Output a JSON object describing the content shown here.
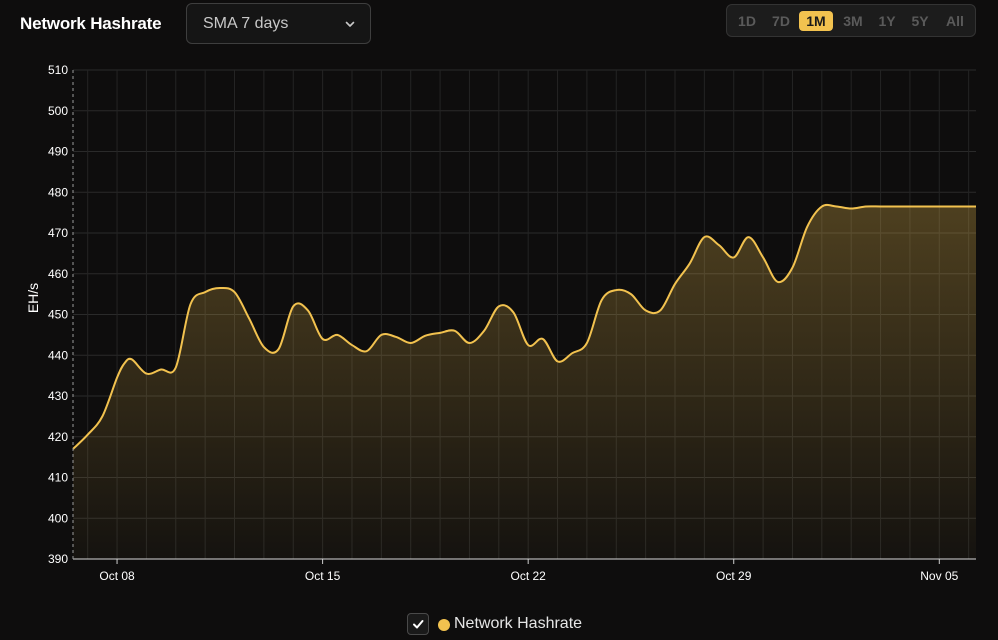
{
  "header": {
    "title": "Network Hashrate",
    "select_value": "SMA 7 days"
  },
  "range": {
    "options": [
      "1D",
      "7D",
      "1M",
      "3M",
      "1Y",
      "5Y",
      "All"
    ],
    "active": "1M"
  },
  "legend": {
    "label": "Network Hashrate"
  },
  "colors": {
    "accent": "#f2c24f",
    "background": "#0e0d0d",
    "grid": "#2a2a2a"
  },
  "chart_data": {
    "type": "area",
    "title": "",
    "xlabel": "",
    "ylabel": "EH/s",
    "ylim": [
      390,
      510
    ],
    "yticks": [
      390,
      400,
      410,
      420,
      430,
      440,
      450,
      460,
      470,
      480,
      490,
      500,
      510
    ],
    "xlim": [
      "2023-10-06 12:00",
      "2023-11-06 06:00"
    ],
    "xticks": [
      {
        "label": "Oct 08",
        "date": "2023-10-08"
      },
      {
        "label": "Oct 15",
        "date": "2023-10-15"
      },
      {
        "label": "Oct 22",
        "date": "2023-10-22"
      },
      {
        "label": "Oct 29",
        "date": "2023-10-29"
      },
      {
        "label": "Nov 05",
        "date": "2023-11-05"
      }
    ],
    "grid": true,
    "legend_position": "bottom",
    "series": [
      {
        "name": "Network Hashrate",
        "x": [
          "2023-10-06 12:00",
          "2023-10-07 00:00",
          "2023-10-07 12:00",
          "2023-10-08 00:00",
          "2023-10-08 06:00",
          "2023-10-08 12:00",
          "2023-10-09 00:00",
          "2023-10-09 12:00",
          "2023-10-10 00:00",
          "2023-10-10 12:00",
          "2023-10-11 00:00",
          "2023-10-11 12:00",
          "2023-10-12 00:00",
          "2023-10-12 12:00",
          "2023-10-13 00:00",
          "2023-10-13 12:00",
          "2023-10-14 00:00",
          "2023-10-14 12:00",
          "2023-10-15 00:00",
          "2023-10-15 12:00",
          "2023-10-16 00:00",
          "2023-10-16 12:00",
          "2023-10-17 00:00",
          "2023-10-17 12:00",
          "2023-10-18 00:00",
          "2023-10-18 12:00",
          "2023-10-19 00:00",
          "2023-10-19 12:00",
          "2023-10-20 00:00",
          "2023-10-20 12:00",
          "2023-10-21 00:00",
          "2023-10-21 12:00",
          "2023-10-22 00:00",
          "2023-10-22 12:00",
          "2023-10-23 00:00",
          "2023-10-23 12:00",
          "2023-10-24 00:00",
          "2023-10-24 12:00",
          "2023-10-25 00:00",
          "2023-10-25 12:00",
          "2023-10-26 00:00",
          "2023-10-26 12:00",
          "2023-10-27 00:00",
          "2023-10-27 12:00",
          "2023-10-28 00:00",
          "2023-10-28 12:00",
          "2023-10-29 00:00",
          "2023-10-29 12:00",
          "2023-10-30 00:00",
          "2023-10-30 12:00",
          "2023-10-31 00:00",
          "2023-10-31 12:00",
          "2023-11-01 00:00",
          "2023-11-01 12:00",
          "2023-11-02 00:00",
          "2023-11-02 12:00",
          "2023-11-03 00:00",
          "2023-11-03 12:00",
          "2023-11-04 00:00",
          "2023-11-04 12:00",
          "2023-11-05 00:00",
          "2023-11-05 12:00",
          "2023-11-06 00:00",
          "2023-11-06 06:00"
        ],
        "y": [
          417,
          420.5,
          425,
          434.5,
          438,
          439,
          435.5,
          436.5,
          437,
          452.5,
          455.5,
          456.5,
          455.5,
          449,
          442,
          441.5,
          452,
          451,
          444,
          445,
          442.5,
          441,
          445,
          444.5,
          443,
          444.8,
          445.5,
          446,
          443,
          446,
          452,
          450.5,
          442.5,
          444,
          438.5,
          440.5,
          443,
          453.5,
          456,
          455,
          451,
          451,
          457.5,
          462.5,
          469,
          467,
          464,
          469,
          464,
          458,
          461.5,
          471.5,
          476.5,
          476.5,
          476,
          476.5,
          476.5,
          476.5,
          476.5,
          476.5,
          476.5,
          476.5,
          476.5,
          476.5
        ]
      }
    ]
  }
}
